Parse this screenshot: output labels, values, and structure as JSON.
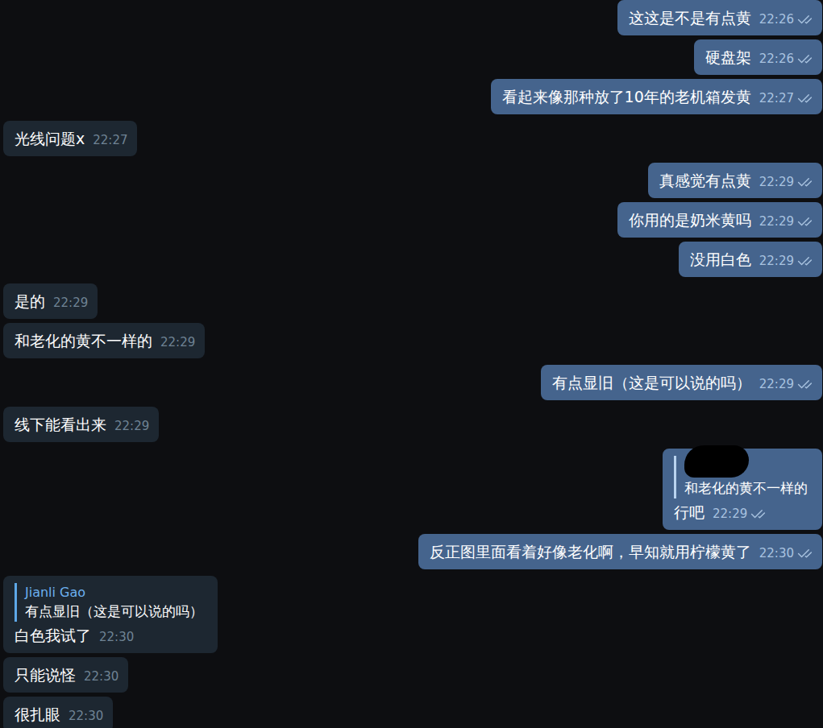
{
  "chat": {
    "messages": [
      {
        "side": "out",
        "kind": "text",
        "text": "这这是不是有点黄",
        "time": "22:26",
        "read": true
      },
      {
        "side": "out",
        "kind": "text",
        "text": "硬盘架",
        "time": "22:26",
        "read": true
      },
      {
        "side": "out",
        "kind": "text",
        "text": "看起来像那种放了10年的老机箱发黄",
        "time": "22:27",
        "read": true
      },
      {
        "side": "in",
        "kind": "text",
        "text": "光线问题x",
        "time": "22:27",
        "read": false
      },
      {
        "side": "out",
        "kind": "text",
        "text": "真感觉有点黄",
        "time": "22:29",
        "read": true
      },
      {
        "side": "out",
        "kind": "text",
        "text": "你用的是奶米黄吗",
        "time": "22:29",
        "read": true
      },
      {
        "side": "out",
        "kind": "text",
        "text": "没用白色",
        "time": "22:29",
        "read": true
      },
      {
        "side": "in",
        "kind": "text",
        "text": "是的",
        "time": "22:29",
        "read": false
      },
      {
        "side": "in",
        "kind": "text",
        "text": "和老化的黄不一样的",
        "time": "22:29",
        "read": false
      },
      {
        "side": "out",
        "kind": "text",
        "text": "有点显旧（这是可以说的吗）",
        "time": "22:29",
        "read": true
      },
      {
        "side": "in",
        "kind": "text",
        "text": "线下能看出来",
        "time": "22:29",
        "read": false
      },
      {
        "side": "out",
        "kind": "reply",
        "reply": {
          "name": "",
          "redacted": true,
          "text": "和老化的黄不一样的"
        },
        "text": "行吧",
        "time": "22:29",
        "read": true
      },
      {
        "side": "out",
        "kind": "text",
        "text": "反正图里面看着好像老化啊，早知就用柠檬黄了",
        "time": "22:30",
        "read": true
      },
      {
        "side": "in",
        "kind": "reply",
        "reply": {
          "name": "Jianli Gao",
          "redacted": false,
          "text": "有点显旧（这是可以说的吗）"
        },
        "text": "白色我试了",
        "time": "22:30",
        "read": false
      },
      {
        "side": "in",
        "kind": "text",
        "text": "只能说怪",
        "time": "22:30",
        "read": false
      },
      {
        "side": "in",
        "kind": "text",
        "text": "很扎眼",
        "time": "22:30",
        "read": false
      }
    ]
  }
}
